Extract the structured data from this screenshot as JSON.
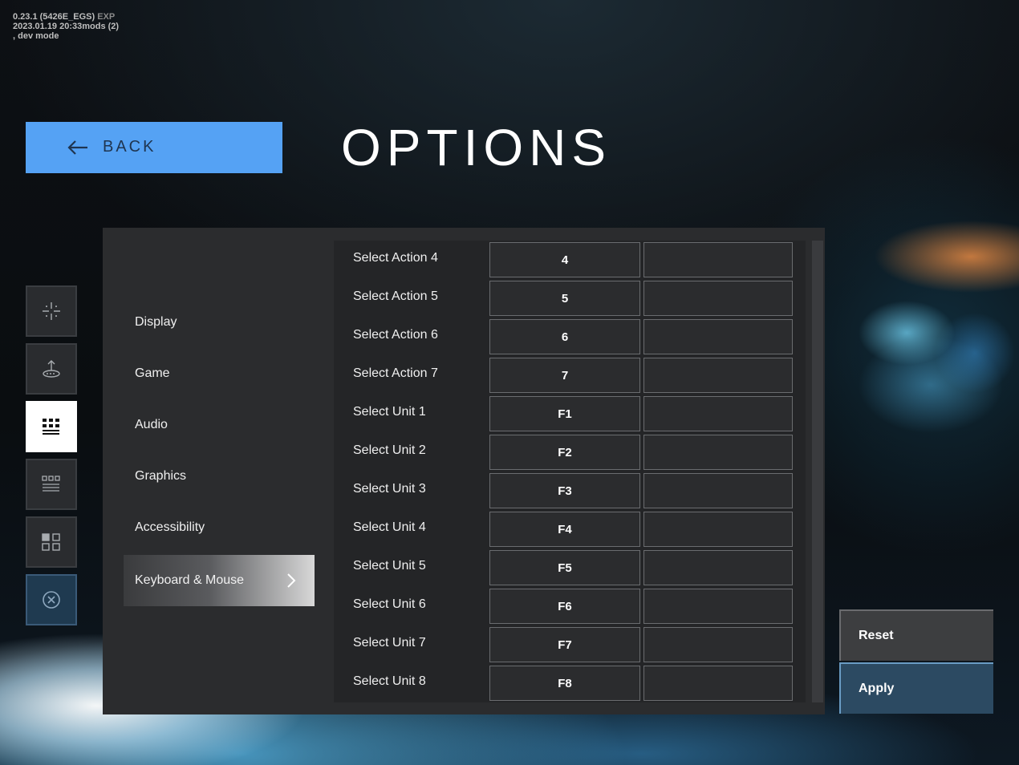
{
  "version": {
    "line1_main": "0.23.1 (5426E_EGS)",
    "line1_tag": "EXP",
    "line2": "2023.01.19 20:33mods (2)",
    "line3": ", dev mode"
  },
  "header": {
    "back_label": "BACK",
    "title": "OPTIONS"
  },
  "rail": {
    "icons": [
      "crosshair-icon",
      "upload-icon",
      "keyboard-grid-icon",
      "grid-small-icon",
      "grid-large-icon",
      "close-circle-icon"
    ],
    "active_index": 2
  },
  "categories": {
    "items": [
      "Display",
      "Game",
      "Audio",
      "Graphics",
      "Accessibility",
      "Keyboard & Mouse"
    ],
    "selected": "Keyboard & Mouse"
  },
  "bindings": {
    "rows": [
      {
        "action": "Select Action 4",
        "primary": "4",
        "secondary": ""
      },
      {
        "action": "Select Action 5",
        "primary": "5",
        "secondary": ""
      },
      {
        "action": "Select Action 6",
        "primary": "6",
        "secondary": ""
      },
      {
        "action": "Select Action 7",
        "primary": "7",
        "secondary": ""
      },
      {
        "action": "Select Unit 1",
        "primary": "F1",
        "secondary": ""
      },
      {
        "action": "Select Unit 2",
        "primary": "F2",
        "secondary": ""
      },
      {
        "action": "Select Unit 3",
        "primary": "F3",
        "secondary": ""
      },
      {
        "action": "Select Unit 4",
        "primary": "F4",
        "secondary": ""
      },
      {
        "action": "Select Unit 5",
        "primary": "F5",
        "secondary": ""
      },
      {
        "action": "Select Unit 6",
        "primary": "F6",
        "secondary": ""
      },
      {
        "action": "Select Unit 7",
        "primary": "F7",
        "secondary": ""
      },
      {
        "action": "Select Unit 8",
        "primary": "F8",
        "secondary": ""
      }
    ]
  },
  "actions": {
    "reset_label": "Reset",
    "apply_label": "Apply"
  },
  "colors": {
    "back_button": "#55a2f4",
    "panel": "#2b2c2e",
    "apply_button": "#2c4a62"
  }
}
